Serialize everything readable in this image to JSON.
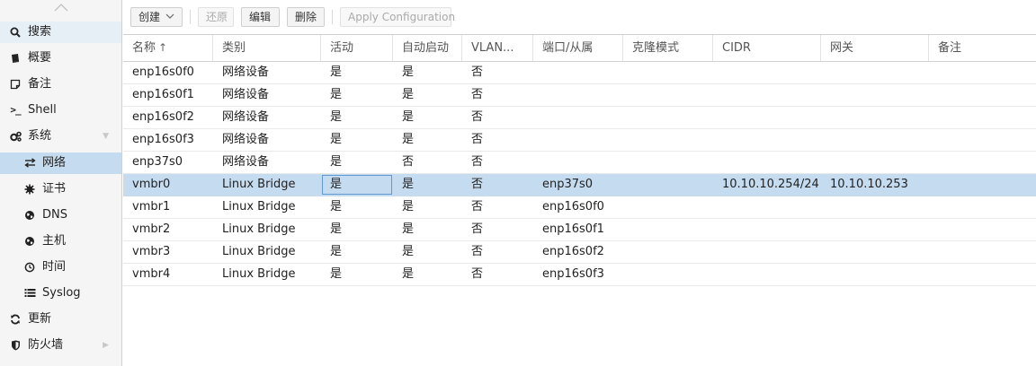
{
  "sidebar": {
    "items": [
      {
        "label": "搜索",
        "icon": "search-icon"
      },
      {
        "label": "概要",
        "icon": "book-icon"
      },
      {
        "label": "备注",
        "icon": "note-icon"
      },
      {
        "label": "Shell",
        "icon": "terminal-icon"
      },
      {
        "label": "系统",
        "icon": "cogs-icon"
      },
      {
        "label": "网络",
        "icon": "exchange-icon"
      },
      {
        "label": "证书",
        "icon": "certificate-icon"
      },
      {
        "label": "DNS",
        "icon": "globe-icon"
      },
      {
        "label": "主机",
        "icon": "globe-icon"
      },
      {
        "label": "时间",
        "icon": "clock-icon"
      },
      {
        "label": "Syslog",
        "icon": "list-icon"
      },
      {
        "label": "更新",
        "icon": "refresh-icon"
      },
      {
        "label": "防火墙",
        "icon": "shield-icon"
      }
    ],
    "selected": "网络"
  },
  "toolbar": {
    "create": "创建",
    "revert": "还原",
    "edit": "编辑",
    "remove": "删除",
    "apply": "Apply Configuration"
  },
  "grid": {
    "columns": [
      "名称",
      "类别",
      "活动",
      "自动启动",
      "VLAN...",
      "端口/从属",
      "克隆模式",
      "CIDR",
      "网关",
      "备注"
    ],
    "sort_indicator": "↑",
    "rows": [
      [
        "enp16s0f0",
        "网络设备",
        "是",
        "是",
        "否",
        "",
        "",
        "",
        "",
        ""
      ],
      [
        "enp16s0f1",
        "网络设备",
        "是",
        "是",
        "否",
        "",
        "",
        "",
        "",
        ""
      ],
      [
        "enp16s0f2",
        "网络设备",
        "是",
        "是",
        "否",
        "",
        "",
        "",
        "",
        ""
      ],
      [
        "enp16s0f3",
        "网络设备",
        "是",
        "是",
        "否",
        "",
        "",
        "",
        "",
        ""
      ],
      [
        "enp37s0",
        "网络设备",
        "是",
        "否",
        "否",
        "",
        "",
        "",
        "",
        ""
      ],
      [
        "vmbr0",
        "Linux Bridge",
        "是",
        "是",
        "否",
        "enp37s0",
        "",
        "10.10.10.254/24",
        "10.10.10.253",
        ""
      ],
      [
        "vmbr1",
        "Linux Bridge",
        "是",
        "是",
        "否",
        "enp16s0f0",
        "",
        "",
        "",
        ""
      ],
      [
        "vmbr2",
        "Linux Bridge",
        "是",
        "是",
        "否",
        "enp16s0f1",
        "",
        "",
        "",
        ""
      ],
      [
        "vmbr3",
        "Linux Bridge",
        "是",
        "是",
        "否",
        "enp16s0f2",
        "",
        "",
        "",
        ""
      ],
      [
        "vmbr4",
        "Linux Bridge",
        "是",
        "是",
        "否",
        "enp16s0f3",
        "",
        "",
        "",
        ""
      ]
    ],
    "selected_row": 5
  },
  "colors": {
    "selection": "#c5dcf0",
    "sidebar_bg": "#f5f5f5"
  }
}
